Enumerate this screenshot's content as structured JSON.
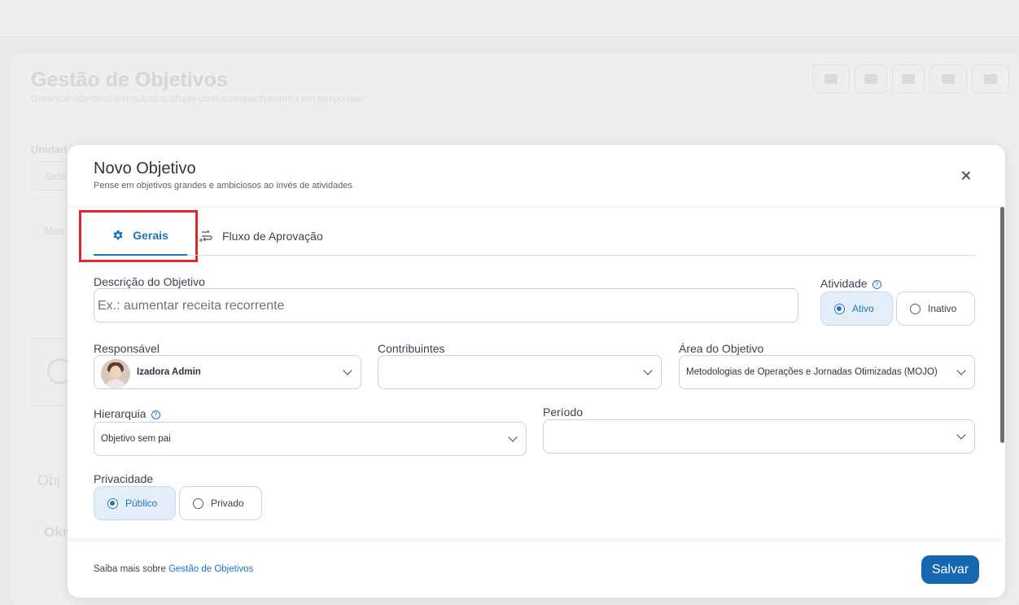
{
  "background": {
    "title": "Gestão de Objetivos",
    "subtitle": "Gerencie objetivos e resultados chave com acompanhamento em tempo real",
    "unit_label": "Unidad",
    "select_placeholder": "Sele",
    "mos_label": "Mos",
    "obj_label": "Obj",
    "okr_label": "Okr"
  },
  "modal": {
    "title": "Novo Objetivo",
    "subtitle": "Pense em objetivos grandes e ambiciosos ao invés de atividades",
    "tabs": [
      {
        "label": "Gerais",
        "icon": "gear-icon",
        "active": true
      },
      {
        "label": "Fluxo de Aprovação",
        "icon": "flow-icon",
        "active": false
      }
    ],
    "description": {
      "label": "Descrição do Objetivo",
      "placeholder": "Ex.: aumentar receita recorrente"
    },
    "activity": {
      "label": "Atividade",
      "options": [
        "Ativo",
        "Inativo"
      ],
      "selected": "Ativo"
    },
    "responsible": {
      "label": "Responsável",
      "value": "Izadora Admin"
    },
    "contributors": {
      "label": "Contribuintes",
      "value": ""
    },
    "area": {
      "label": "Área do Objetivo",
      "value": "Metodologias de Operações e Jornadas Otimizadas (MOJO)"
    },
    "hierarchy": {
      "label": "Hierarquia",
      "value": "Objetivo sem pai"
    },
    "period": {
      "label": "Período",
      "value": ""
    },
    "privacy": {
      "label": "Privacidade",
      "options": [
        "Público",
        "Privado"
      ],
      "selected": "Público"
    },
    "footer": {
      "text": "Saiba mais sobre",
      "link": "Gestão de Objetivos",
      "save_label": "Salvar"
    }
  },
  "colors": {
    "accent": "#1f74be",
    "save_button": "#1467b0",
    "highlight": "#e0272e"
  }
}
